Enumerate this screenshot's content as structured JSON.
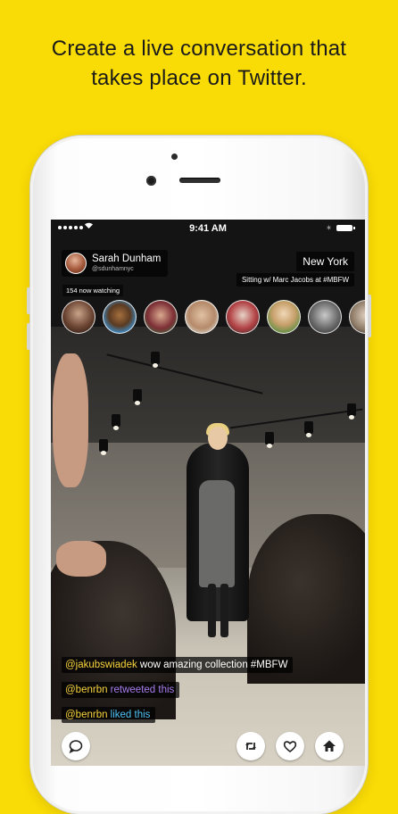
{
  "headline": {
    "line1": "Create a live conversation that",
    "line2": "takes place on Twitter."
  },
  "status_bar": {
    "time": "9:41 AM",
    "signal_icon": "signal-dots-icon",
    "wifi_icon": "wifi-icon",
    "bluetooth_icon": "bluetooth-icon",
    "battery_icon": "battery-icon"
  },
  "broadcast": {
    "host_name": "Sarah Dunham",
    "host_handle": "@sdunhamnyc",
    "location": "New York",
    "title": "Sitting w/ Marc Jacobs at #MBFW",
    "watching": "154 now watching"
  },
  "comments": [
    {
      "handle": "@jakubswiadek",
      "text": " wow amazing collection #MBFW"
    },
    {
      "handle": "@benrbn",
      "text": " retweeted this"
    },
    {
      "handle": "@benrbn",
      "text": " liked this"
    }
  ],
  "colors": {
    "background": "#F9DB06",
    "handle": "#F7D33C",
    "retweet": "#A87DF0",
    "like": "#4FC3F7"
  },
  "controls": {
    "chat_icon": "chat-bubble-icon",
    "retweet_icon": "retweet-icon",
    "heart_icon": "heart-icon",
    "home_icon": "home-icon"
  }
}
